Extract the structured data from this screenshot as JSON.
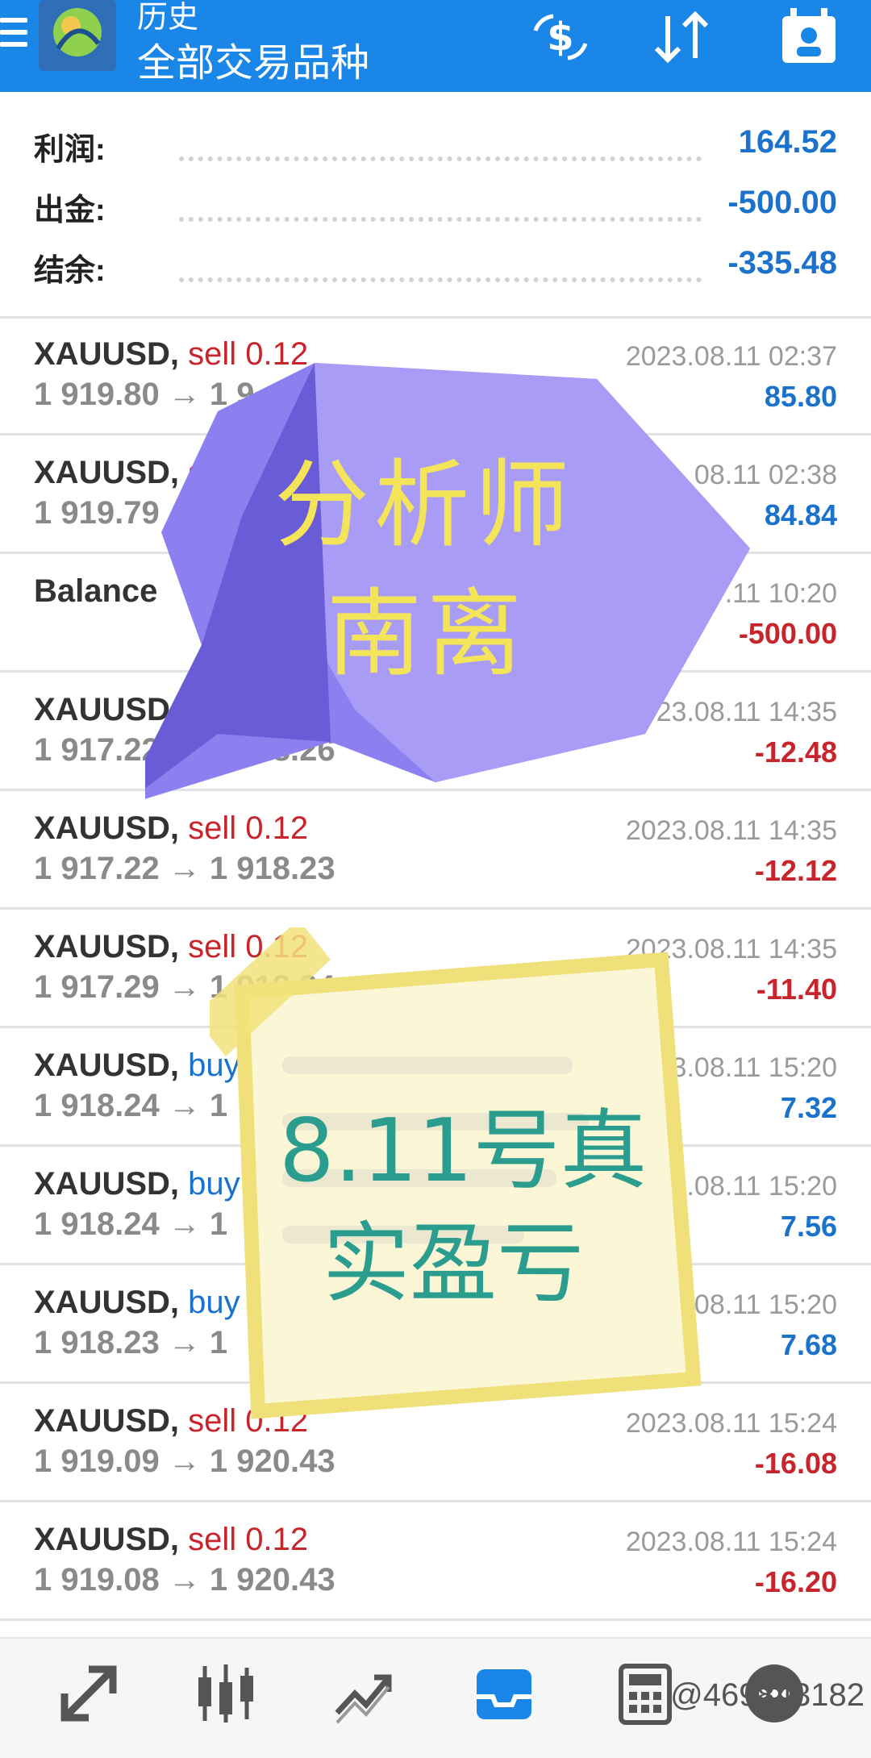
{
  "header": {
    "subtitle": "历史",
    "title": "全部交易品种",
    "color_bg": "#1a86e8",
    "actions": [
      "currency-exchange-icon",
      "sort-icon",
      "calendar-icon"
    ]
  },
  "summary": [
    {
      "label": "利润:",
      "value": "164.52"
    },
    {
      "label": "出金:",
      "value": "-500.00"
    },
    {
      "label": "结余:",
      "value": "-335.48"
    }
  ],
  "trades": [
    {
      "symbol": "XAUUSD,",
      "side": "sell 0.12",
      "prices": "1 919.80 → 1 9",
      "time": "2023.08.11 02:37",
      "profit": "85.80"
    },
    {
      "symbol": "XAUUSD,",
      "side": "s",
      "prices": "1 919.79",
      "time": "08.11 02:38",
      "profit": "84.84"
    },
    {
      "symbol": "Balance",
      "side": "",
      "prices": "",
      "time": ".11 10:20",
      "profit": "-500.00"
    },
    {
      "symbol": "XAUUSD,",
      "side": "sel",
      "prices": "1 917.22 → 1 918.26",
      "time": "23.08.11 14:35",
      "profit": "-12.48"
    },
    {
      "symbol": "XAUUSD,",
      "side": "sell 0.12",
      "prices": "1 917.22 → 1 918.23",
      "time": "2023.08.11 14:35",
      "profit": "-12.12"
    },
    {
      "symbol": "XAUUSD,",
      "side": "sell 0.12",
      "prices": "1 917.29 → 1 918.24",
      "time": "2023.08.11 14:35",
      "profit": "-11.40"
    },
    {
      "symbol": "XAUUSD,",
      "side": "buy",
      "prices": "1 918.24 → 1",
      "time": "23.08.11 15:20",
      "profit": "7.32"
    },
    {
      "symbol": "XAUUSD,",
      "side": "buy 0",
      "prices": "1 918.24 → 1",
      "time": "23.08.11 15:20",
      "profit": "7.56"
    },
    {
      "symbol": "XAUUSD,",
      "side": "buy 0",
      "prices": "1 918.23 → 1",
      "time": "23.08.11 15:20",
      "profit": "7.68"
    },
    {
      "symbol": "XAUUSD,",
      "side": "sell 0.12",
      "prices": "1 919.09 → 1 920.43",
      "time": "2023.08.11 15:24",
      "profit": "-16.08"
    },
    {
      "symbol": "XAUUSD,",
      "side": "sell 0.12",
      "prices": "1 919.08 → 1 920.43",
      "time": "2023.08.11 15:24",
      "profit": "-16.20"
    }
  ],
  "overlay_bubble": {
    "line1": "分析师",
    "line2": "南离"
  },
  "overlay_note": {
    "line1": "8.11号真",
    "line2": "实盈亏"
  },
  "watermark": "@469843182",
  "nav": [
    "trade-arrows-icon",
    "chart-candles-icon",
    "trend-icon",
    "inbox-icon",
    "calculator-icon",
    "chat-icon"
  ]
}
